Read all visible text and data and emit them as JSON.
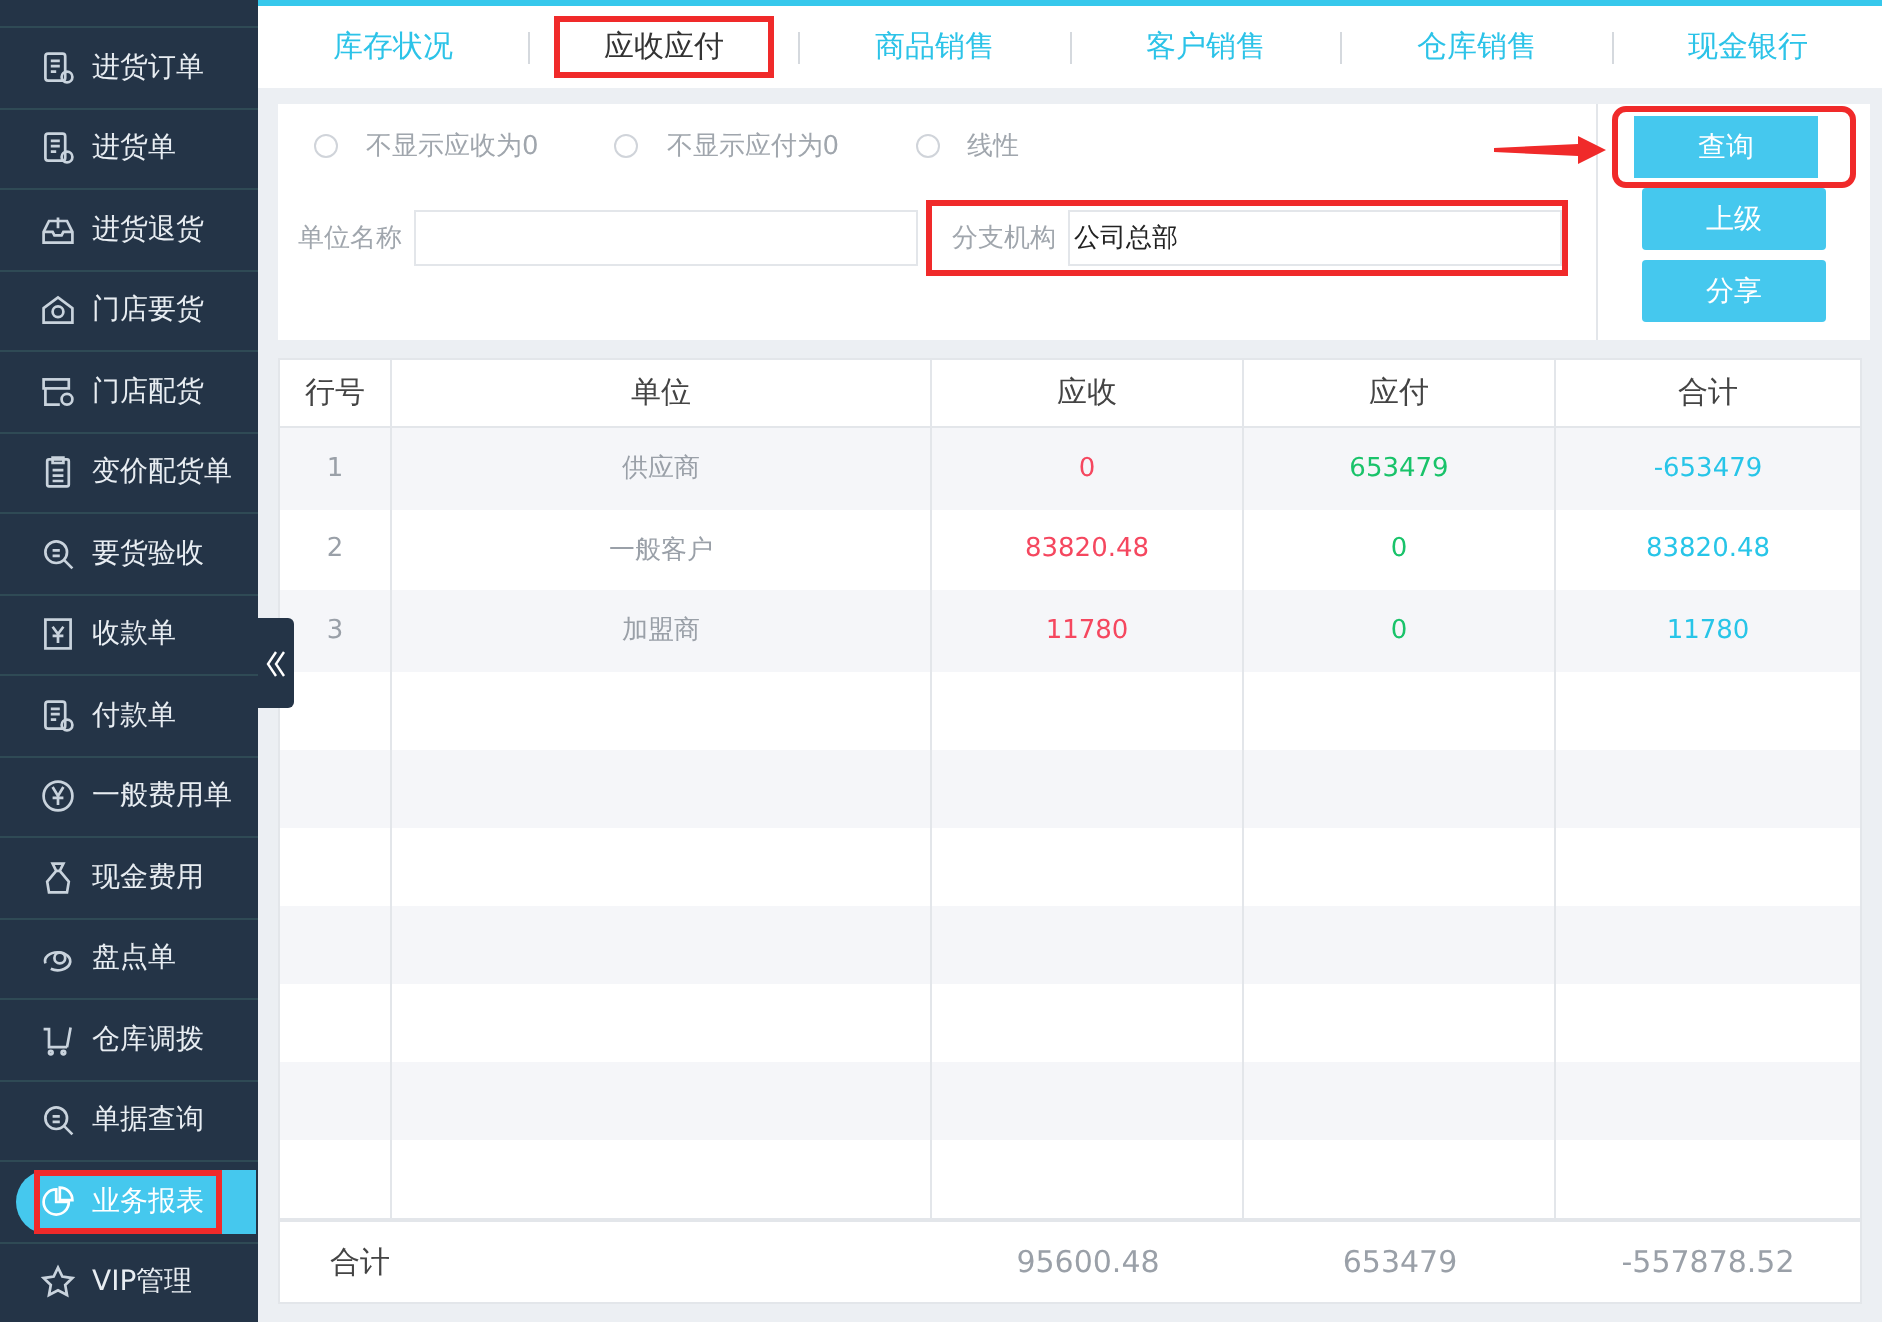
{
  "sidebar": {
    "items": [
      {
        "label": "进货订单",
        "selected": false,
        "highlighted": false
      },
      {
        "label": "进货单",
        "selected": false,
        "highlighted": false
      },
      {
        "label": "进货退货",
        "selected": false,
        "highlighted": false
      },
      {
        "label": "门店要货",
        "selected": false,
        "highlighted": false
      },
      {
        "label": "门店配货",
        "selected": false,
        "highlighted": false
      },
      {
        "label": "变价配货单",
        "selected": false,
        "highlighted": false
      },
      {
        "label": "要货验收",
        "selected": false,
        "highlighted": false
      },
      {
        "label": "收款单",
        "selected": false,
        "highlighted": false
      },
      {
        "label": "付款单",
        "selected": false,
        "highlighted": false
      },
      {
        "label": "一般费用单",
        "selected": false,
        "highlighted": false
      },
      {
        "label": "现金费用",
        "selected": false,
        "highlighted": false
      },
      {
        "label": "盘点单",
        "selected": false,
        "highlighted": false
      },
      {
        "label": "仓库调拨",
        "selected": false,
        "highlighted": false
      },
      {
        "label": "单据查询",
        "selected": false,
        "highlighted": false
      },
      {
        "label": "业务报表",
        "selected": true,
        "highlighted": true
      },
      {
        "label": "VIP管理",
        "selected": false,
        "highlighted": false
      }
    ]
  },
  "tabs": [
    {
      "label": "库存状况",
      "selected": false,
      "highlighted": false
    },
    {
      "label": "应收应付",
      "selected": true,
      "highlighted": true
    },
    {
      "label": "商品销售",
      "selected": false,
      "highlighted": false
    },
    {
      "label": "客户销售",
      "selected": false,
      "highlighted": false
    },
    {
      "label": "仓库销售",
      "selected": false,
      "highlighted": false
    },
    {
      "label": "现金银行",
      "selected": false,
      "highlighted": false
    }
  ],
  "filters": {
    "options": [
      {
        "label": "不显示应收为0",
        "checked": false
      },
      {
        "label": "不显示应付为0",
        "checked": false
      },
      {
        "label": "线性",
        "checked": false
      }
    ],
    "fields": [
      {
        "label": "单位名称",
        "highlighted": false
      },
      {
        "label": "分支机构",
        "value": "公司总部",
        "highlighted": true
      }
    ]
  },
  "buttons": [
    {
      "label": "查询",
      "highlighted": true,
      "pointed": true
    },
    {
      "label": "上级",
      "highlighted": false,
      "pointed": false
    },
    {
      "label": "分享",
      "highlighted": false,
      "pointed": false
    }
  ],
  "table": {
    "columns": [
      "行号",
      "单位",
      "应收",
      "应付",
      "合计"
    ],
    "rows": [
      [
        "1",
        "供应商",
        "0",
        "653479",
        "-653479"
      ],
      [
        "2",
        "一般客户",
        "83820.48",
        "0",
        "83820.48"
      ],
      [
        "3",
        "加盟商",
        "11780",
        "0",
        "11780"
      ]
    ],
    "footer": {
      "label": "合计",
      "receivable": "95600.48",
      "payable": "653479",
      "total": "-557878.52"
    }
  }
}
